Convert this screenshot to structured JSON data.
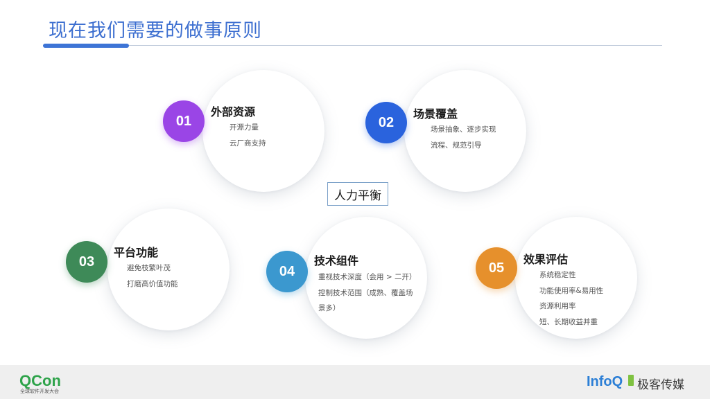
{
  "slide": {
    "title": "现在我们需要的做事原则",
    "center_label": "人力平衡"
  },
  "principles": [
    {
      "number": "01",
      "heading": "外部资源",
      "color": "#9a45e6",
      "lines": [
        "开源力量",
        "云厂商支持"
      ]
    },
    {
      "number": "02",
      "heading": "场景覆盖",
      "color": "#2a63dd",
      "lines": [
        "场景抽象、逐步实现",
        "流程、规范引导"
      ]
    },
    {
      "number": "03",
      "heading": "平台功能",
      "color": "#3e8a58",
      "lines": [
        "避免枝繁叶茂",
        "打磨高价值功能"
      ]
    },
    {
      "number": "04",
      "heading": "技术组件",
      "color": "#3b98cf",
      "lines": [
        "重视技术深度（会用 > 二开）",
        "控制技术范围（成熟、覆盖场",
        "景多）"
      ]
    },
    {
      "number": "05",
      "heading": "效果评估",
      "color": "#e6902c",
      "lines": [
        "系统稳定性",
        "功能使用率&易用性",
        "资源利用率",
        "短、长期收益并重"
      ]
    }
  ],
  "footer": {
    "qcon_logo": "QCon",
    "qcon_tagline": "全球软件开发大会",
    "infoq_logo": "InfoQ",
    "jike_text": "极客传媒"
  }
}
